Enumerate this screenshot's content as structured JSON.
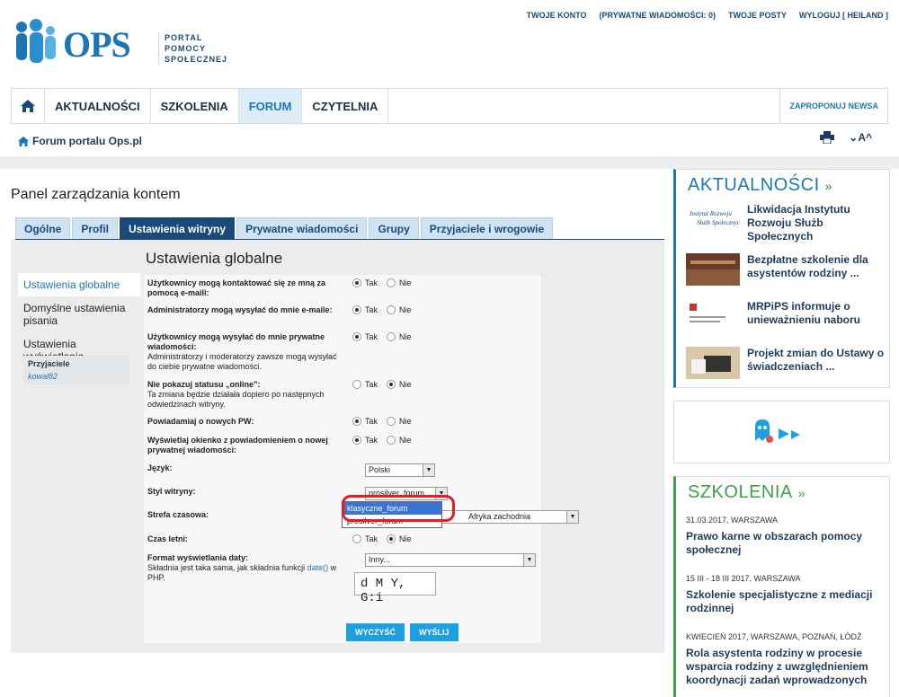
{
  "top_links": [
    "TWOJE KONTO",
    "(PRYWATNE WIADOMOŚCI: 0)",
    "TWOJE POSTY",
    "WYLOGUJ [ HEILAND ]"
  ],
  "logo": {
    "name": "OPS",
    "subtitle": [
      "PORTAL",
      "POMOCY",
      "SPOŁECZNEJ"
    ]
  },
  "main_nav": {
    "items": [
      "AKTUALNOŚCI",
      "SZKOLENIA",
      "FORUM",
      "CZYTELNIA"
    ],
    "active": "FORUM",
    "propose": "ZAPROPONUJ NEWSA"
  },
  "breadcrumb": "Forum portalu Ops.pl",
  "font_size_control": "A^",
  "panel": {
    "title": "Panel zarządzania kontem",
    "tabs": [
      "Ogólne",
      "Profil",
      "Ustawienia witryny",
      "Prywatne wiadomości",
      "Grupy",
      "Przyjaciele i wrogowie"
    ],
    "active_tab": "Ustawienia witryny",
    "side_menu": [
      "Ustawienia globalne",
      "Domyślne ustawienia pisania",
      "Ustawienia wyświetlania"
    ],
    "friends_header": "Przyjaciele",
    "friends": [
      "kowal82"
    ],
    "form_title": "Ustawienia globalne",
    "yes": "Tak",
    "no": "Nie",
    "settings": [
      {
        "label": "Użytkownicy mogą kontaktować się ze mną za pomocą e-maili:",
        "note": "",
        "value": "Tak"
      },
      {
        "label": "Administratorzy mogą wysyłać do mnie e-maile:",
        "note": "",
        "value": "Tak"
      },
      {
        "label": "Użytkownicy mogą wysyłać do mnie prywatne wiadomości:",
        "note": "Administratorzy i moderatorzy zawsze mogą wysyłać do ciebie prywatne wiadomości.",
        "value": "Tak"
      },
      {
        "label": "Nie pokazuj statusu „online”:",
        "note": "Ta zmiana będzie działała dopiero po następnych odwiedzinach witryny.",
        "value": "Nie"
      },
      {
        "label": "Powiadamiaj o nowych PW:",
        "note": "",
        "value": "Tak"
      },
      {
        "label": "Wyświetlaj okienko z powiadomieniem o nowej prywatnej wiadomości:",
        "note": "",
        "value": "Tak"
      }
    ],
    "language_label": "Język:",
    "language_value": "Polski",
    "style_label": "Styl witryny:",
    "style_value": "prosilver_forum",
    "style_options": [
      "klasyczne_forum",
      "prosilver_forum"
    ],
    "style_highlighted": "klasyczne_forum",
    "timezone_label": "Strefa czasowa:",
    "timezone_value": "Afryka zachodnia",
    "dst_label": "Czas letni:",
    "dst_value": "Nie",
    "date_label": "Format wyświetlania daty:",
    "date_note_pre": "Składnia jest taka sama, jak składnia funkcji",
    "date_note_link": "date()",
    "date_note_post": "w PHP.",
    "date_select": "Inny...",
    "date_format": "d M Y, G:i",
    "btn_reset": "WYCZYŚĆ",
    "btn_submit": "WYŚLIJ"
  },
  "right": {
    "news_title": "AKTUALNOŚCI",
    "news": [
      "Likwidacja Instytutu Rozwoju Służb Społecznych",
      "Bezpłatne szkolenie dla asystentów rodziny ...",
      "MRPiPS informuje o unieważnieniu naboru",
      "Projekt zmian do Ustawy o świadczeniach ..."
    ],
    "trainings_title": "SZKOLENIA",
    "trainings": [
      {
        "date": "31.03.2017, WARSZAWA",
        "title": "Prawo karne w obszarach pomocy społecznej"
      },
      {
        "date": "15 III - 18 III 2017, WARSZAWA",
        "title": "Szkolenie specjalistyczne z mediacji rodzinnej"
      },
      {
        "date": "KWIECIEŃ 2017, WARSZAWA, POZNAŃ, ŁÓDŹ",
        "title": "Rola asystenta rodziny w procesie wsparcia rodziny z uwzględnieniem koordynacji zadań wprowadzonych"
      }
    ]
  },
  "colors": {
    "brand": "#1d75b3",
    "tab_active": "#1a4a7a",
    "button": "#1e9fe0",
    "highlight_ring": "#e02020",
    "green_accent": "#3aa34a"
  }
}
